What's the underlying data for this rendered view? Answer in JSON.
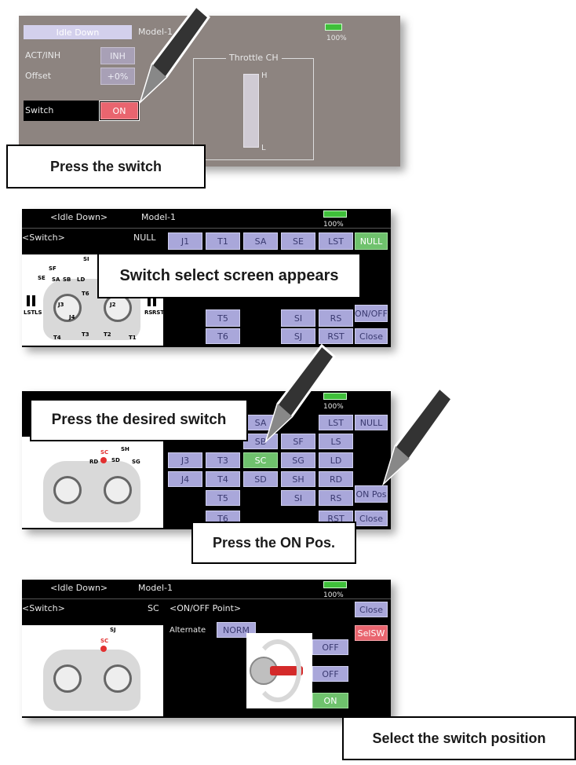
{
  "panel1": {
    "tab": "Idle Down",
    "model": "Model-1",
    "battery_pct": "100%",
    "act_label": "ACT/INH",
    "act_value": "INH",
    "offset_label": "Offset",
    "offset_value": "+0%",
    "switch_label": "Switch",
    "switch_value": "ON",
    "throttle_title": "Throttle CH",
    "throttle_high": "H",
    "throttle_low": "L",
    "callout": "Press the switch"
  },
  "panel2": {
    "tab": "<Idle Down>",
    "model": "Model-1",
    "battery_pct": "100%",
    "switch_label": "<Switch>",
    "switch_value": "NULL",
    "grid_row1": [
      "J1",
      "T1",
      "SA",
      "SE",
      "LST",
      "NULL"
    ],
    "row4": [
      "T5",
      "SI",
      "RS",
      "ON/OFF"
    ],
    "row5": [
      "T6",
      "SJ",
      "RST",
      "Close"
    ],
    "callout": "Switch select screen appears"
  },
  "panel3": {
    "battery_pct": "100%",
    "grid": [
      [
        "SA",
        "LST",
        "NULL"
      ],
      [
        "SB",
        "SF",
        "LS"
      ],
      [
        "J3",
        "T3",
        "SC",
        "SG",
        "LD"
      ],
      [
        "J4",
        "T4",
        "SD",
        "SH",
        "RD"
      ],
      [
        "T5",
        "SI",
        "RS",
        "ON Pos"
      ],
      [
        "T6",
        "RST",
        "Close"
      ]
    ],
    "callout_top": "Press the desired switch",
    "callout_bottom": "Press the ON Pos."
  },
  "panel4": {
    "tab": "<Idle Down>",
    "model": "Model-1",
    "battery_pct": "100%",
    "switch_label": "<Switch>",
    "switch_value": "SC",
    "onoff_title": "<ON/OFF Point>",
    "close": "Close",
    "selsw": "SelSW",
    "alternate_label": "Alternate",
    "alternate_value": "NORM",
    "positions": [
      "OFF",
      "OFF",
      "ON"
    ],
    "callout": "Select the switch position"
  },
  "diagram_labels": {
    "sf": "SF",
    "se": "SE",
    "sa": "SA",
    "sb": "SB",
    "si": "SI",
    "ld": "LD",
    "t6": "T6",
    "t5": "T5",
    "t4": "T4",
    "t3": "T3",
    "t2": "T2",
    "t1": "T1",
    "j3": "J3",
    "j4": "J4",
    "j2": "J2",
    "j1": "J1",
    "lst": "LST",
    "ls": "LS",
    "rs": "RS",
    "rst": "RST",
    "sh": "SH",
    "sj": "SJ",
    "sc": "SC",
    "sd": "SD",
    "sg": "SG",
    "rd": "RD"
  },
  "colors": {
    "selected_green": "#6fc26d",
    "active_red": "#e9656f",
    "button_lavender": "#a9a7da",
    "screen_gray": "#8d8480"
  },
  "icons": [
    "pen-stylus-icon",
    "battery-icon",
    "transmitter-diagram"
  ]
}
